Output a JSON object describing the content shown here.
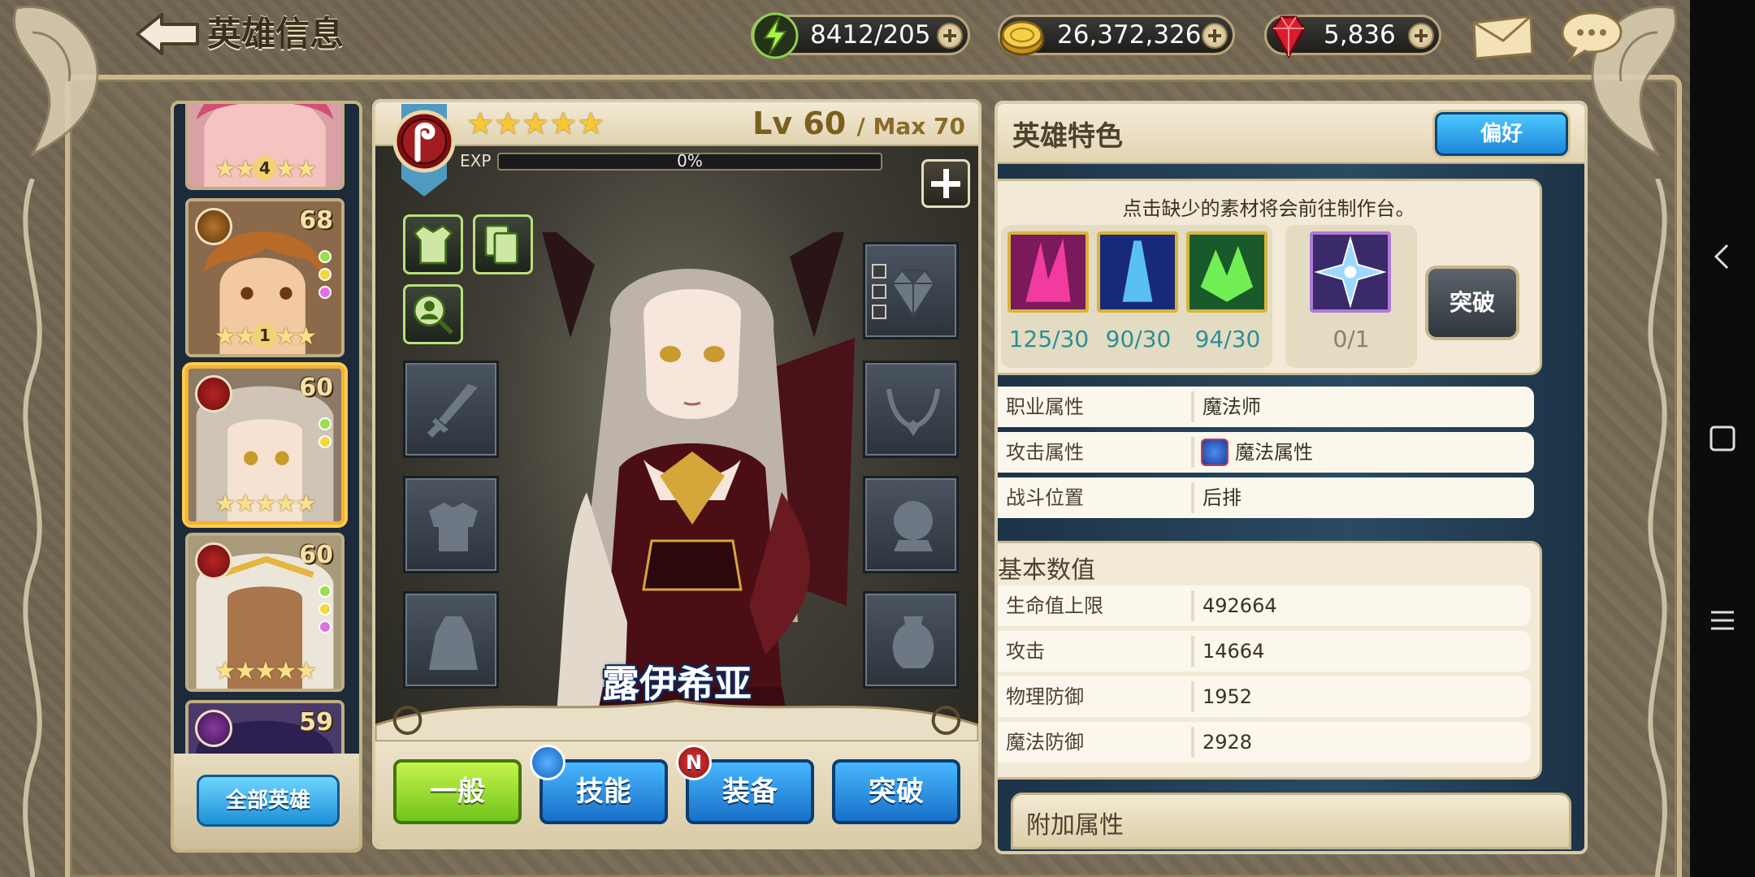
{
  "header": {
    "title": "英雄信息"
  },
  "currencies": {
    "stamina": "8412/205",
    "gold": "26,372,326",
    "gems": "5,836"
  },
  "hero_list": {
    "cards": [
      {
        "level": "",
        "rank": "4",
        "stars": "★★★★★"
      },
      {
        "level": "68",
        "rank": "1",
        "stars": "★★★★★"
      },
      {
        "level": "60",
        "rank": "",
        "stars": "★★★★★"
      },
      {
        "level": "60",
        "rank": "",
        "stars": "★★★★★"
      },
      {
        "level": "59",
        "rank": "",
        "stars": ""
      }
    ],
    "all_heroes_label": "全部英雄"
  },
  "hero": {
    "name": "露伊希亚",
    "stars": "★★★★★",
    "level": "Lv 60",
    "max_level": "/ Max 70",
    "exp_label": "EXP",
    "exp_text": "0%",
    "exp_fraction": 0
  },
  "tabs": [
    {
      "label": "一般"
    },
    {
      "label": "技能"
    },
    {
      "label": "装备",
      "badge": "N"
    },
    {
      "label": "突破"
    }
  ],
  "traits": {
    "title": "英雄特色",
    "preference_label": "偏好",
    "hint": "点击缺少的素材将会前往制作台。",
    "materials": [
      "125/30",
      "90/30",
      "94/30"
    ],
    "special_material": "0/1",
    "breakthrough_label": "突破",
    "attributes": [
      {
        "key": "职业属性",
        "value": "魔法师"
      },
      {
        "key": "攻击属性",
        "value": "魔法属性"
      },
      {
        "key": "战斗位置",
        "value": "后排"
      }
    ]
  },
  "base_stats": {
    "title": "基本数值",
    "rows": [
      {
        "key": "生命值上限",
        "value": "492664"
      },
      {
        "key": "攻击",
        "value": "14664"
      },
      {
        "key": "物理防御",
        "value": "1952"
      },
      {
        "key": "魔法防御",
        "value": "2928"
      }
    ]
  },
  "extra_stats": {
    "title": "附加属性"
  },
  "icons": {
    "back": "back-arrow-icon",
    "stamina": "lightning-icon",
    "gold": "gold-coin-icon",
    "gems": "ruby-icon",
    "mail": "mail-icon",
    "chat": "chat-bubble-icon",
    "class": "magic-staff-icon"
  },
  "colors": {
    "tab_active": "#9ad32b",
    "tab_default": "#2a8fe0",
    "material_count": "#2c8f95"
  }
}
